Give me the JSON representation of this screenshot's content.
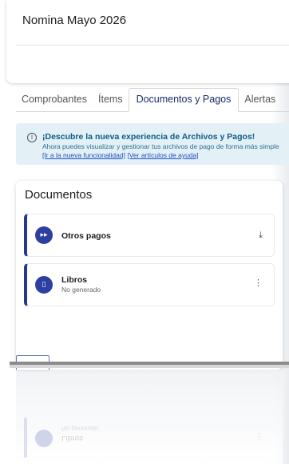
{
  "header": {
    "title": "Nomina Mayo 2026"
  },
  "tabs": [
    {
      "label": "Comprobantes"
    },
    {
      "label": "Ítems"
    },
    {
      "label": "Documentos y Pagos"
    },
    {
      "label": "Alertas"
    }
  ],
  "active_tab": "Documentos y Pagos",
  "banner": {
    "icon": "info-icon",
    "title": "¡Descubre la nueva experiencia de Archivos y Pagos!",
    "text": "Ahora puedes visualizar y gestionar tus archivos de pago de forma más simple",
    "link_new": "[Ir a la nueva funcionalidad]",
    "link_help": "[Ver artículos de ayuda]"
  },
  "documents": {
    "title": "Documentos",
    "items": [
      {
        "name": "Otros pagos",
        "status": "",
        "icon": "payments-icon",
        "action_icon": "download-icon"
      },
      {
        "name": "Libros",
        "status": "No generado",
        "icon": "document-icon",
        "action_icon": "more-vertical-icon"
      }
    ]
  },
  "reflection": {
    "name": "Libros",
    "status": "No generado"
  },
  "colors": {
    "accent": "#253a8f",
    "banner_bg": "#e3f1f7",
    "banner_title": "#0f5a8a",
    "link": "#1f4fbf"
  }
}
